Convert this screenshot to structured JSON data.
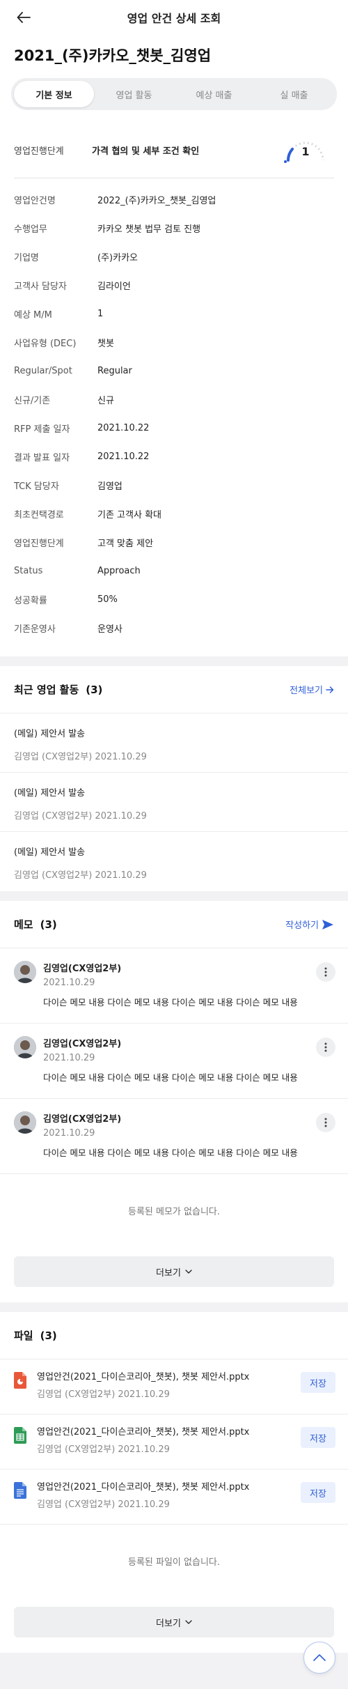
{
  "header": {
    "title": "영업 안건 상세 조회"
  },
  "main_title": "2021_(주)카카오_챗봇_김영업",
  "tabs": [
    {
      "label": "기본 정보",
      "active": true
    },
    {
      "label": "영업 활동",
      "active": false
    },
    {
      "label": "예상 매출",
      "active": false
    },
    {
      "label": "실 매출",
      "active": false
    }
  ],
  "stage": {
    "label": "영업진행단계",
    "value": "가격 협의 및 세부 조건 확인",
    "gauge_number": "1"
  },
  "info": [
    {
      "label": "영업안건명",
      "value": "2022_(주)카카오_챗봇_김영업"
    },
    {
      "label": "수행업무",
      "value": "카카오 챗봇 법무 검토 진행"
    },
    {
      "label": "기업명",
      "value": "(주)카카오"
    },
    {
      "label": "고객사 담당자",
      "value": "김라이언"
    },
    {
      "label": "예상 M/M",
      "value": "1"
    },
    {
      "label": "사업유형 (DEC)",
      "value": "챗봇"
    },
    {
      "label": "Regular/Spot",
      "value": "Regular"
    },
    {
      "label": "신규/기존",
      "value": "신규"
    },
    {
      "label": "RFP 제출 일자",
      "value": "2021.10.22"
    },
    {
      "label": "결과 발표 일자",
      "value": "2021.10.22"
    },
    {
      "label": "TCK 담당자",
      "value": "김영업"
    },
    {
      "label": "최초컨택경로",
      "value": "기존 고객사 확대"
    },
    {
      "label": "영업진행단계",
      "value": "고객 맞춤 제안"
    },
    {
      "label": "Status",
      "value": "Approach"
    },
    {
      "label": "성공확률",
      "value": "50%"
    },
    {
      "label": "기존운영사",
      "value": "운영사"
    }
  ],
  "activity": {
    "title": "최근 영업 활동",
    "count": "(3)",
    "link_label": "전체보기",
    "items": [
      {
        "title": "(메일) 제안서 발송",
        "meta": "김영업 (CX영업2부) 2021.10.29"
      },
      {
        "title": "(메일) 제안서 발송",
        "meta": "김영업 (CX영업2부) 2021.10.29"
      },
      {
        "title": "(메일) 제안서 발송",
        "meta": "김영업 (CX영업2부) 2021.10.29"
      }
    ]
  },
  "memo": {
    "title": "메모",
    "count": "(3)",
    "link_label": "작성하기",
    "items": [
      {
        "name": "김영업(CX영업2부)",
        "date": "2021.10.29",
        "text": "다이슨 메모 내용 다이슨 메모 내용 다이슨 메모 내용 다이슨 메모 내용"
      },
      {
        "name": "김영업(CX영업2부)",
        "date": "2021.10.29",
        "text": "다이슨 메모 내용 다이슨 메모 내용 다이슨 메모 내용 다이슨 메모 내용"
      },
      {
        "name": "김영업(CX영업2부)",
        "date": "2021.10.29",
        "text": "다이슨 메모 내용 다이슨 메모 내용 다이슨 메모 내용 다이슨 메모 내용"
      }
    ],
    "empty_text": "등록된 메모가 없습니다.",
    "more_label": "더보기"
  },
  "files": {
    "title": "파일",
    "count": "(3)",
    "items": [
      {
        "name": "영업안건(2021_다이슨코리아_챗봇), 챗봇 제안서.pptx",
        "meta": "김영업 (CX영업2부) 2021.10.29",
        "icon": "powerpoint-file-icon",
        "save_label": "저장"
      },
      {
        "name": "영업안건(2021_다이슨코리아_챗봇), 챗봇 제안서.pptx",
        "meta": "김영업 (CX영업2부) 2021.10.29",
        "icon": "spreadsheet-file-icon",
        "save_label": "저장"
      },
      {
        "name": "영업안건(2021_다이슨코리아_챗봇), 챗봇 제안서.pptx",
        "meta": "김영업 (CX영업2부) 2021.10.29",
        "icon": "document-file-icon",
        "save_label": "저장"
      }
    ],
    "empty_text": "등록된 파일이 없습니다.",
    "more_label": "더보기"
  },
  "colors": {
    "accent": "#2f5fd7",
    "gauge_active": "#2f5fd7",
    "ppt": "#e8573a",
    "sheet": "#2e9b57",
    "doc": "#3b72d9"
  }
}
